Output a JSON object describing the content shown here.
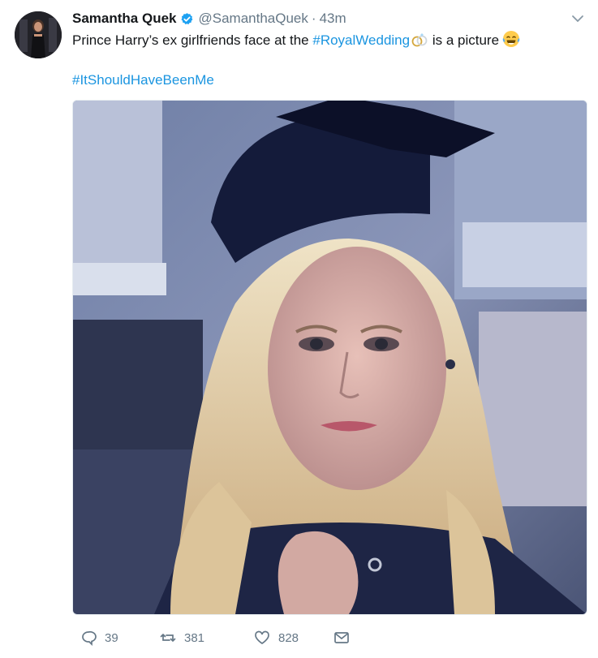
{
  "tweet": {
    "author_name": "Samantha Quek",
    "handle": "@SamanthaQuek",
    "separator": "·",
    "time": "43m",
    "text_before": "Prince Harry’s ex girlfriends face at the ",
    "hashtag_inline": "#RoyalWedding",
    "text_after": " is a picture",
    "hashtag_line": "#ItShouldHaveBeenMe"
  },
  "actions": {
    "replies": "39",
    "retweets": "381",
    "likes": "828"
  },
  "icons": {
    "verified": "verified-badge-icon",
    "caret": "chevron-down-icon",
    "ring": "ring-emoji-icon",
    "laugh": "tears-of-joy-emoji-icon",
    "reply": "reply-icon",
    "retweet": "retweet-icon",
    "like": "heart-icon",
    "dm": "envelope-icon"
  },
  "colors": {
    "link": "#1b95e0",
    "secondary": "#657786",
    "verified": "#1da1f2"
  }
}
